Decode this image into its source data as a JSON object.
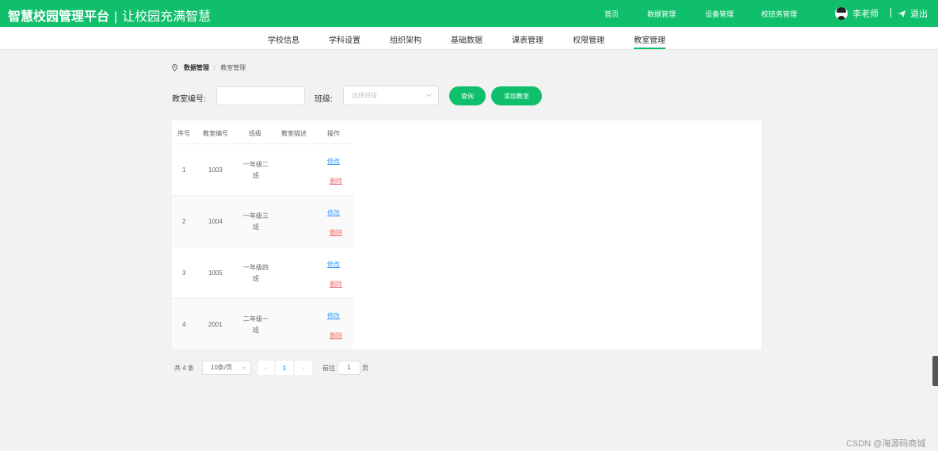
{
  "header": {
    "title": "智慧校园管理平台",
    "separator": "|",
    "slogan": "让校园充满智慧",
    "nav": [
      "首页",
      "数据管理",
      "设备管理",
      "校班务管理"
    ],
    "user_name": "李老师",
    "logout_label": "退出",
    "brand_color": "#0fbf6b"
  },
  "subnav": {
    "tabs": [
      "学校信息",
      "学科设置",
      "组织架构",
      "基础数据",
      "课表管理",
      "权限管理",
      "教室管理"
    ],
    "active": "教室管理"
  },
  "breadcrumb": {
    "parent": "数据管理",
    "separator": "/",
    "current": "教室管理"
  },
  "search": {
    "room_no_label": "教室编号:",
    "room_no_value": "",
    "class_label": "班级:",
    "class_placeholder": "选择班级",
    "query_button": "查询",
    "add_button": "添加教室"
  },
  "table": {
    "columns": [
      "序号",
      "教室编号",
      "班级",
      "教室描述",
      "操作"
    ],
    "rows": [
      {
        "index": "1",
        "room_no": "1003",
        "class": "一年级二班",
        "desc": "",
        "edit": "修改",
        "delete": "删除"
      },
      {
        "index": "2",
        "room_no": "1004",
        "class": "一年级三班",
        "desc": "",
        "edit": "修改",
        "delete": "删除"
      },
      {
        "index": "3",
        "room_no": "1005",
        "class": "一年级四班",
        "desc": "",
        "edit": "修改",
        "delete": "删除"
      },
      {
        "index": "4",
        "room_no": "2001",
        "class": "二年级一班",
        "desc": "",
        "edit": "修改",
        "delete": "删除"
      }
    ]
  },
  "pagination": {
    "total": "共 4 条",
    "page_size": "10条/页",
    "prev": "‹",
    "current_page": "1",
    "next": "›",
    "goto_label": "前往",
    "goto_value": "1",
    "page_suffix": "页"
  },
  "watermark": "CSDN @海源码商城"
}
